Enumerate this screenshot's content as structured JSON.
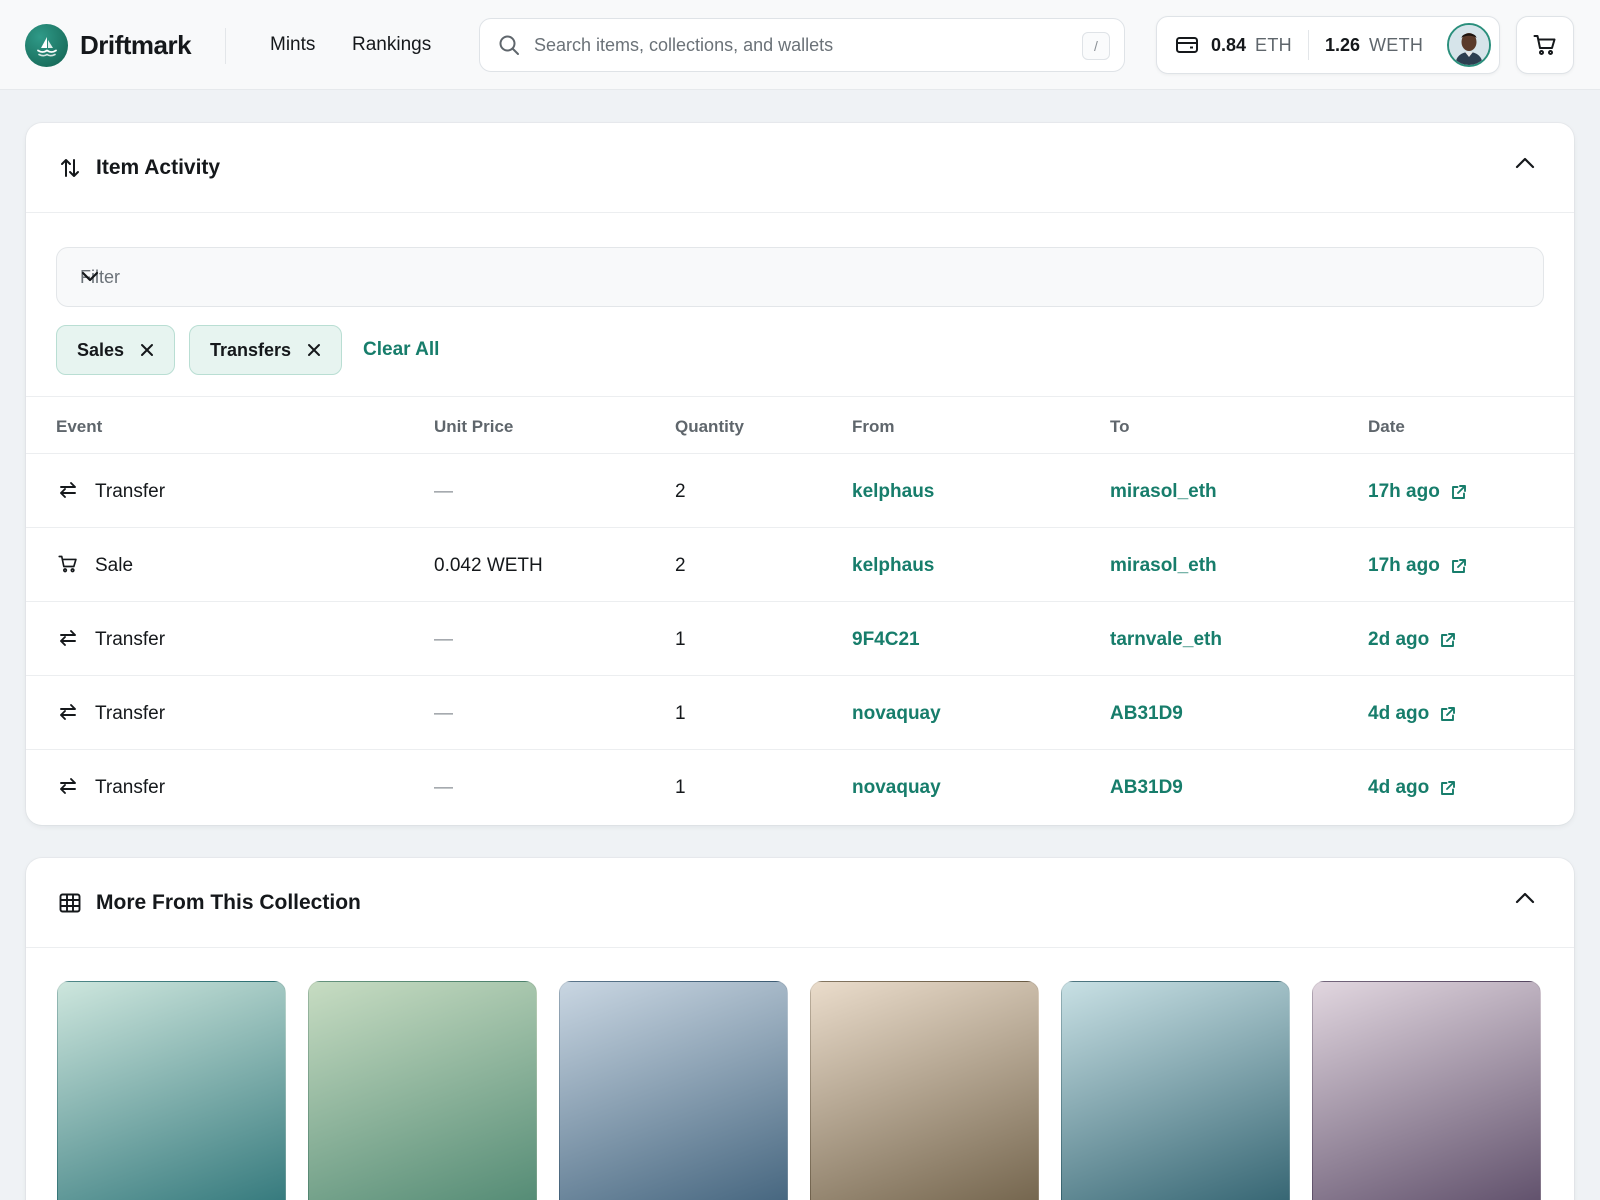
{
  "app": {
    "name": "Driftmark"
  },
  "nav": {
    "mints": "Mints",
    "rankings": "Rankings"
  },
  "search": {
    "placeholder": "Search items, collections, and wallets",
    "shortcut": "/"
  },
  "wallet": {
    "eth_value": "0.84",
    "eth_unit": "ETH",
    "weth_value": "1.26",
    "weth_unit": "WETH"
  },
  "activity": {
    "title": "Item Activity",
    "filter_placeholder": "Filter",
    "chips": [
      {
        "label": "Sales"
      },
      {
        "label": "Transfers"
      }
    ],
    "clear_all": "Clear All",
    "columns": {
      "event": "Event",
      "unit_price": "Unit Price",
      "quantity": "Quantity",
      "from": "From",
      "to": "To",
      "date": "Date"
    },
    "rows": [
      {
        "event": "Transfer",
        "icon": "transfer-icon",
        "price": "—",
        "quantity": "2",
        "from": "kelphaus",
        "to": "mirasol_eth",
        "date": "17h ago"
      },
      {
        "event": "Sale",
        "icon": "cart-icon",
        "price": "0.042 WETH",
        "quantity": "2",
        "from": "kelphaus",
        "to": "mirasol_eth",
        "date": "17h ago"
      },
      {
        "event": "Transfer",
        "icon": "transfer-icon",
        "price": "—",
        "quantity": "1",
        "from": "9F4C21",
        "to": "tarnvale_eth",
        "date": "2d ago"
      },
      {
        "event": "Transfer",
        "icon": "transfer-icon",
        "price": "—",
        "quantity": "1",
        "from": "novaquay",
        "to": "AB31D9",
        "date": "4d ago"
      },
      {
        "event": "Transfer",
        "icon": "transfer-icon",
        "price": "—",
        "quantity": "1",
        "from": "novaquay",
        "to": "AB31D9",
        "date": "4d ago"
      }
    ]
  },
  "collection": {
    "title": "More From This Collection",
    "cards": [
      {
        "from": "#cde6dd",
        "to": "#2d7478"
      },
      {
        "from": "#c7dcc2",
        "to": "#4e8771"
      },
      {
        "from": "#c9d6e2",
        "to": "#3f607a"
      },
      {
        "from": "#eadccb",
        "to": "#6e5f47"
      },
      {
        "from": "#c8e0e4",
        "to": "#2e5f6d"
      },
      {
        "from": "#e1d6df",
        "to": "#5a4a66"
      }
    ]
  },
  "colors": {
    "accent": "#177d6b",
    "chip_bg": "#e7f4f0",
    "page_bg": "#eff2f5"
  }
}
